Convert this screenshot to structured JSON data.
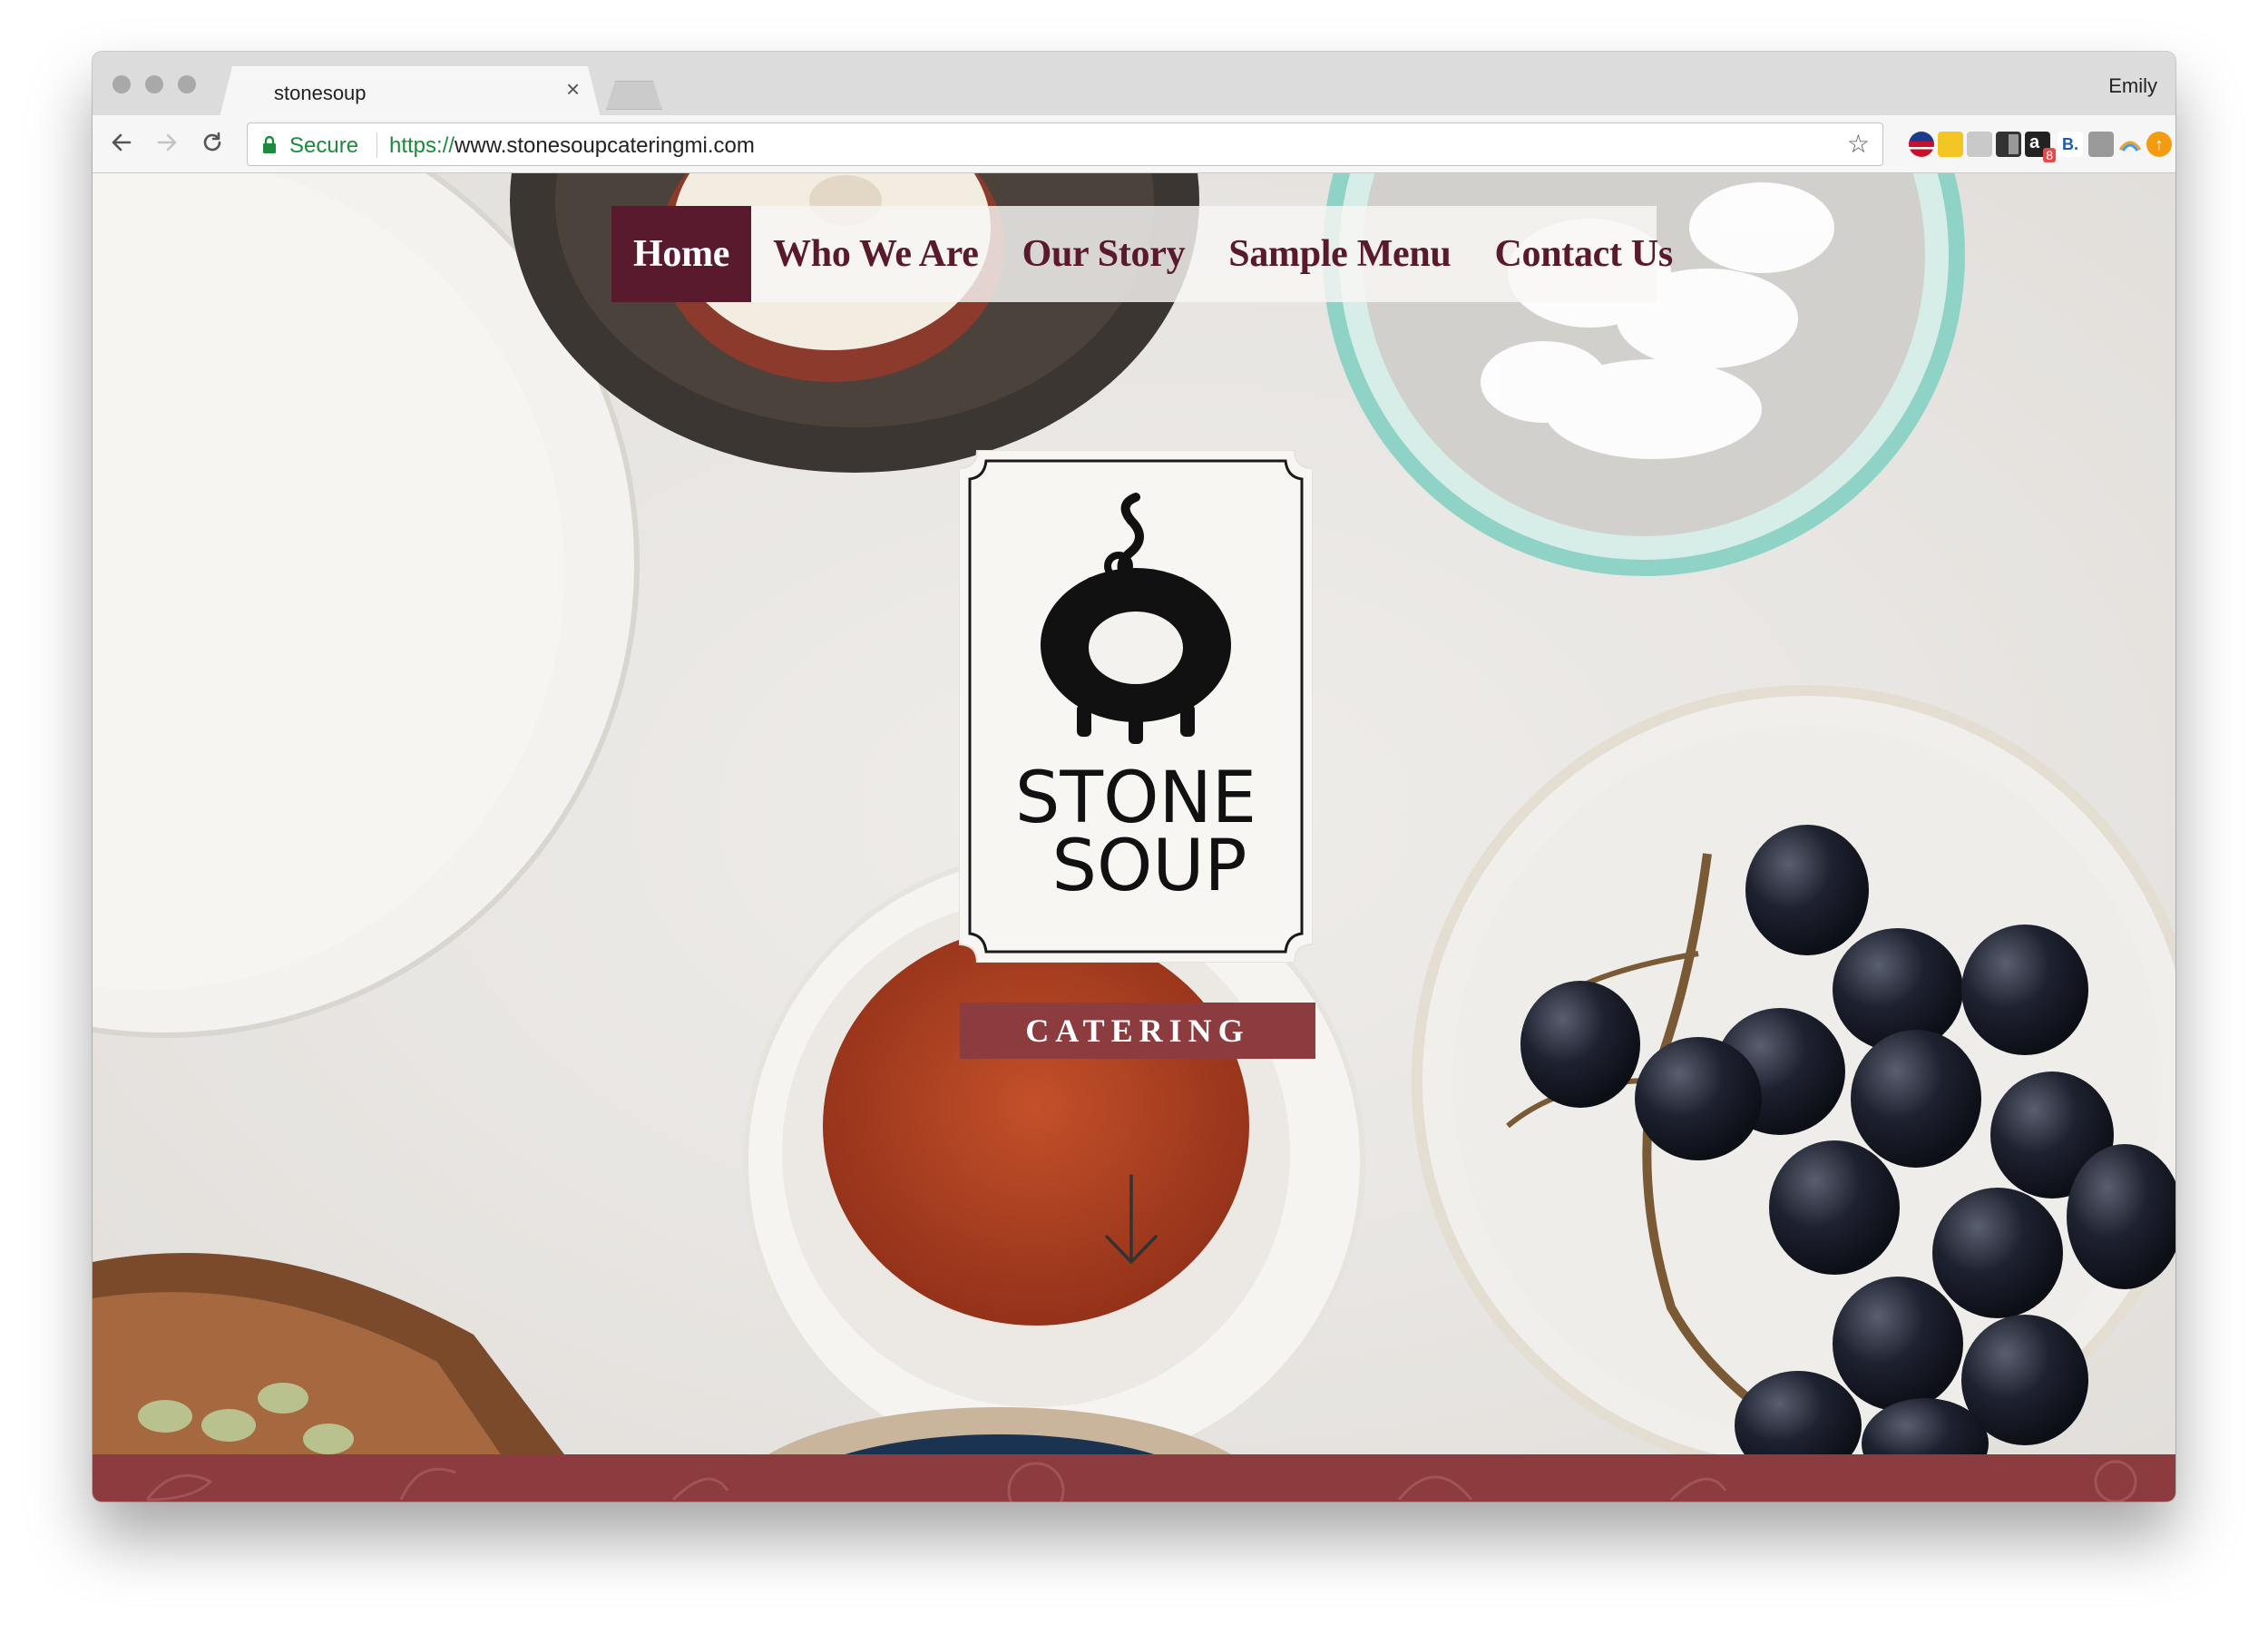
{
  "browser": {
    "tab_title": "stonesoup",
    "profile_name": "Emily",
    "security_label": "Secure",
    "url_scheme": "https://",
    "url_rest": "www.stonesoupcateringmi.com",
    "extensions": [
      "flag-extension-icon",
      "notes-extension-icon",
      "translate-extension-icon",
      "layout-extension-icon",
      "amazon-extension-icon",
      "bitly-extension-icon",
      "pocket-extension-icon",
      "rainbow-extension-icon",
      "honey-extension-icon"
    ],
    "amazon_badge": "8"
  },
  "site": {
    "nav": [
      "Home",
      "Who We Are",
      "Our Story",
      "Sample Menu",
      "Contact Us"
    ],
    "active_nav": "Home",
    "logo_line1": "STONE",
    "logo_line2": "SOUP",
    "tagline": "CATERING",
    "colors": {
      "brand_maroon": "#5a1a2e",
      "banner_red": "#8c3b3e",
      "secure_green": "#1b8a3a"
    }
  }
}
